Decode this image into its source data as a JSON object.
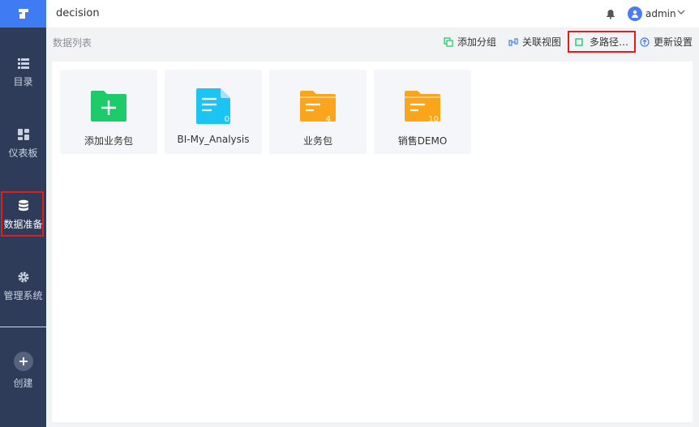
{
  "app": {
    "title": "decision"
  },
  "user": {
    "name": "admin"
  },
  "sidebar": {
    "items": [
      {
        "label": "目录",
        "icon": "list-icon"
      },
      {
        "label": "仪表板",
        "icon": "dashboard-icon"
      },
      {
        "label": "数据准备",
        "icon": "database-icon",
        "active": true
      },
      {
        "label": "管理系统",
        "icon": "gear-icon"
      }
    ],
    "create_label": "创建"
  },
  "toolbar": {
    "section_label": "数据列表",
    "add_group": "添加分组",
    "relation_view": "关联视图",
    "multi_path": "多路径…",
    "update_settings": "更新设置"
  },
  "packages": [
    {
      "name": "添加业务包",
      "type": "add",
      "color": "#1ecb6a"
    },
    {
      "name": "BI-My_Analysis",
      "type": "file",
      "count": "0",
      "color": "#1cc4f4"
    },
    {
      "name": "业务包",
      "type": "folder",
      "count": "4",
      "color": "#fba51d"
    },
    {
      "name": "销售DEMO",
      "type": "folder",
      "count": "10",
      "color": "#fba51d"
    }
  ]
}
